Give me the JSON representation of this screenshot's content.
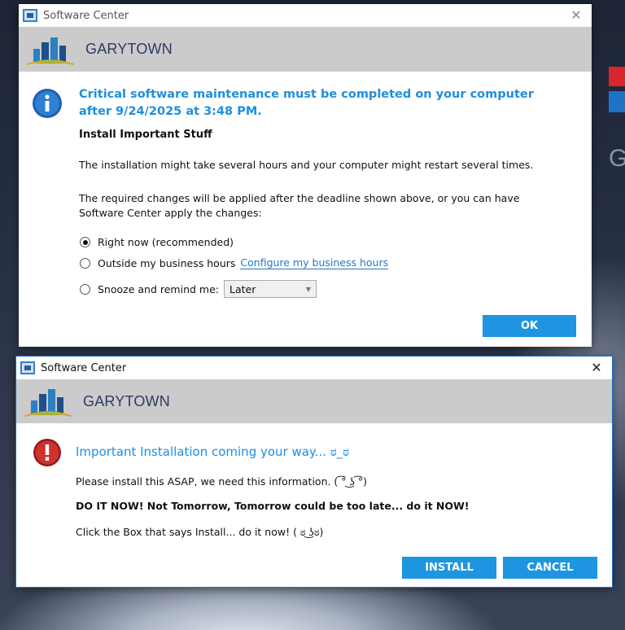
{
  "colors": {
    "accent": "#1e95e0",
    "banner": "#cbcbcb",
    "brand_text": "#2f3b63",
    "heading": "#1d8fe0"
  },
  "dialog1": {
    "title": "Software Center",
    "brand": "GARYTOWN",
    "headline": "Critical software maintenance must be completed on your computer after 9/24/2025 at 3:48 PM.",
    "subheading": "Install Important Stuff",
    "paragraph1": "The installation might take several hours and your computer might restart several times.",
    "paragraph2": "The required changes will be applied after the deadline shown above, or you can have Software Center apply the changes:",
    "options": [
      {
        "label": "Right now (recommended)",
        "selected": true
      },
      {
        "label": "Outside my business hours",
        "selected": false,
        "link": "Configure my business hours"
      },
      {
        "label": "Snooze and remind me:",
        "selected": false,
        "select_value": "Later"
      }
    ],
    "ok_label": "OK",
    "icons": {
      "app": "software-center-icon",
      "logo": "garytown-logo",
      "info": "info-icon",
      "close": "close-icon"
    }
  },
  "dialog2": {
    "title": "Software Center",
    "brand": "GARYTOWN",
    "headline": "Important Installation coming your way... ಠ_ಠ",
    "line1": "Please install this ASAP, we need this information. ( ͡° ͜ʖ ͡°)",
    "line2": "DO IT NOW!  Not Tomorrow, Tomorrow could be too late... do it NOW!",
    "line3": "Click the Box that says Install... do it now! ( ಠ ͜ʖಠ)",
    "install_label": "INSTALL",
    "cancel_label": "CANCEL",
    "icons": {
      "app": "software-center-icon",
      "logo": "garytown-logo",
      "error": "error-icon",
      "close": "close-icon"
    }
  }
}
